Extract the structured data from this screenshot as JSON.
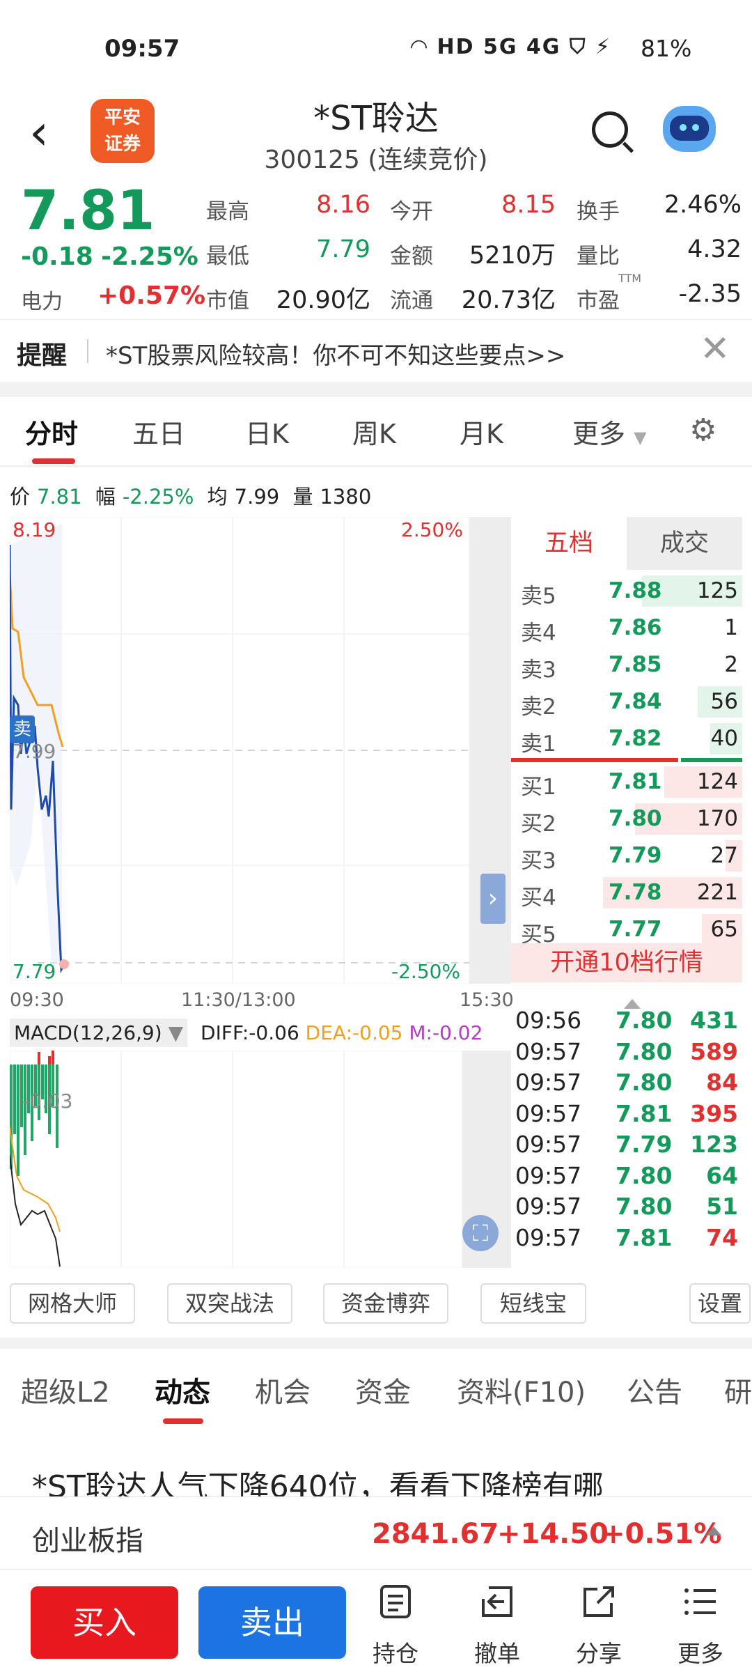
{
  "status_bar": {
    "time": "09:57",
    "battery": "81%",
    "net_icons": "HD 5G 4G"
  },
  "header": {
    "logo_text_1": "平安",
    "logo_text_2": "证券",
    "title": "*ST聆达",
    "subtitle": "300125 (连续竞价)"
  },
  "quote": {
    "price": "7.81",
    "change": "-0.18",
    "change_pct": "-2.25%",
    "elec_label": "电力",
    "elec_value": "+0.57%",
    "fields": [
      {
        "label": "最高",
        "value": "8.16",
        "color": "#e0302f"
      },
      {
        "label": "今开",
        "value": "8.15",
        "color": "#e0302f"
      },
      {
        "label": "换手",
        "value": "2.46%",
        "color": "#222222"
      },
      {
        "label": "最低",
        "value": "7.79",
        "color": "#139a5a"
      },
      {
        "label": "金额",
        "value": "5210万",
        "color": "#222222"
      },
      {
        "label": "量比",
        "value": "4.32",
        "color": "#222222"
      },
      {
        "label": "市值",
        "value": "20.90亿",
        "color": "#222222"
      },
      {
        "label": "流通",
        "value": "20.73亿",
        "color": "#222222"
      },
      {
        "label": "市盈",
        "value": "-2.35",
        "color": "#222222"
      }
    ],
    "ttm": "TTM"
  },
  "alert": {
    "tag": "提醒",
    "text": "*ST股票风险较高！你不可不知这些要点>>"
  },
  "tabs": [
    "分时",
    "五日",
    "日K",
    "周K",
    "月K",
    "更多"
  ],
  "info_line": {
    "price_label": "价",
    "price": "7.81",
    "range_label": "幅",
    "range": "-2.25%",
    "avg_label": "均",
    "avg": "7.99",
    "vol_label": "量",
    "vol": "1380"
  },
  "chart": {
    "y_top": "8.19",
    "y_bottom": "7.79",
    "pct_top": "2.50%",
    "pct_bottom": "-2.50%",
    "mid_label": "7.99",
    "sell_marker": "卖",
    "time_start": "09:30",
    "time_mid": "11:30/13:00",
    "time_end": "15:30",
    "price_line_color": "#1f4aa8",
    "avg_line_color": "#f0a020"
  },
  "chart_data": {
    "type": "line",
    "x_labels": [
      "09:30",
      "11:30/13:00",
      "15:30"
    ],
    "ylim": [
      7.79,
      8.19
    ],
    "series": []
  },
  "order_book": {
    "tab_active": "五档",
    "tab_other": "成交",
    "asks": [
      {
        "label": "卖5",
        "price": "7.88",
        "vol": "125",
        "fill": 0.72
      },
      {
        "label": "卖4",
        "price": "7.86",
        "vol": "1",
        "fill": 0.0
      },
      {
        "label": "卖3",
        "price": "7.85",
        "vol": "2",
        "fill": 0.0
      },
      {
        "label": "卖2",
        "price": "7.84",
        "vol": "56",
        "fill": 0.32
      },
      {
        "label": "卖1",
        "price": "7.82",
        "vol": "40",
        "fill": 0.23
      }
    ],
    "bids": [
      {
        "label": "买1",
        "price": "7.81",
        "vol": "124",
        "fill": 0.56
      },
      {
        "label": "买2",
        "price": "7.80",
        "vol": "170",
        "fill": 0.77
      },
      {
        "label": "买3",
        "price": "7.79",
        "vol": "27",
        "fill": 0.12
      },
      {
        "label": "买4",
        "price": "7.78",
        "vol": "221",
        "fill": 1.0
      },
      {
        "label": "买5",
        "price": "7.77",
        "vol": "65",
        "fill": 0.29
      }
    ],
    "open10": "开通10档行情"
  },
  "macd": {
    "name": "MACD(12,26,9)",
    "diff": "DIFF:-0.06",
    "dea": "DEA:-0.05",
    "m": "M:-0.02",
    "axis_label": "-0.03"
  },
  "ticks": [
    {
      "time": "09:56",
      "price": "7.80",
      "vol": "431",
      "dir": "green"
    },
    {
      "time": "09:57",
      "price": "7.80",
      "vol": "589",
      "dir": "red"
    },
    {
      "time": "09:57",
      "price": "7.80",
      "vol": "84",
      "dir": "red"
    },
    {
      "time": "09:57",
      "price": "7.81",
      "vol": "395",
      "dir": "red"
    },
    {
      "time": "09:57",
      "price": "7.79",
      "vol": "123",
      "dir": "green"
    },
    {
      "time": "09:57",
      "price": "7.80",
      "vol": "64",
      "dir": "green"
    },
    {
      "time": "09:57",
      "price": "7.80",
      "vol": "51",
      "dir": "green"
    },
    {
      "time": "09:57",
      "price": "7.81",
      "vol": "74",
      "dir": "red"
    }
  ],
  "tools": [
    "网格大师",
    "双突战法",
    "资金博弈",
    "短线宝",
    "设置"
  ],
  "bottom_tabs": [
    "超级L2",
    "动态",
    "机会",
    "资金",
    "资料(F10)",
    "公告",
    "研"
  ],
  "news_headline": "*ST聆达人气下降640位，看看下降榜有哪",
  "index_bar": {
    "name": "创业板指",
    "value": "2841.67",
    "change": "+14.50",
    "pct": "+0.51%"
  },
  "actions": {
    "buy": "买入",
    "sell": "卖出",
    "items": [
      "持仓",
      "撤单",
      "分享",
      "更多"
    ]
  }
}
